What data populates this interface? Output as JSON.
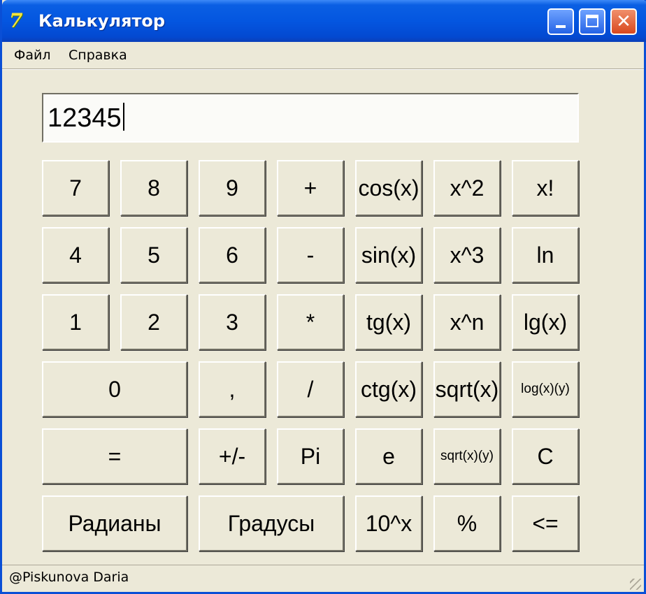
{
  "window": {
    "title": "Калькулятор",
    "icon": "delphi-app-icon"
  },
  "menu": {
    "file": "Файл",
    "help": "Справка"
  },
  "display": {
    "value": "12345"
  },
  "buttons": {
    "seven": "7",
    "eight": "8",
    "nine": "9",
    "plus": "+",
    "cos": "cos(x)",
    "square": "x^2",
    "factorial": "x!",
    "four": "4",
    "five": "5",
    "six": "6",
    "minus": "-",
    "sin": "sin(x)",
    "cube": "x^3",
    "ln": "ln",
    "one": "1",
    "two": "2",
    "three": "3",
    "multiply": "*",
    "tg": "tg(x)",
    "power_n": "x^n",
    "lg": "lg(x)",
    "zero": "0",
    "comma": ",",
    "divide": "/",
    "ctg": "ctg(x)",
    "sqrt": "sqrt(x)",
    "log_xy": "log(x)(y)",
    "equals": "=",
    "plus_minus": "+/-",
    "pi": "Pi",
    "e": "e",
    "root_xy": "sqrt(x)(y)",
    "clear": "C",
    "radians": "Радианы",
    "degrees": "Градусы",
    "ten_power": "10^x",
    "percent": "%",
    "backspace": "<="
  },
  "status": {
    "text": "@Piskunova Daria"
  },
  "colors": {
    "titlebar": "#0456e0",
    "face": "#ece9d8",
    "close_button": "#d9481e"
  }
}
